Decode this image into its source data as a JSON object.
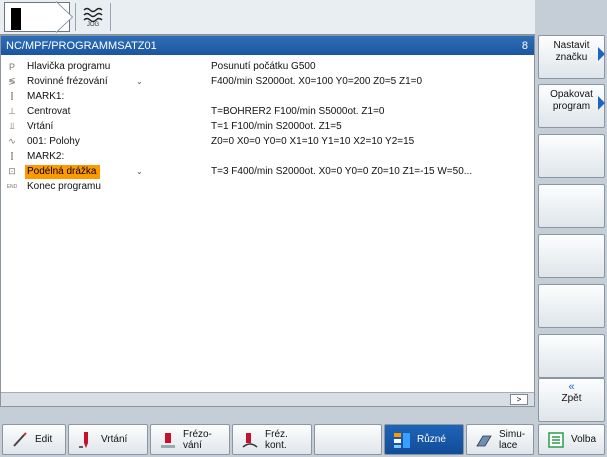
{
  "topbar": {
    "jog_label": "JOG"
  },
  "editor": {
    "path": "NC/MPF/PROGRAMMSATZ01",
    "channel_number": "8",
    "more_button": ">",
    "rows": [
      {
        "icon": "P",
        "icon_name": "program-header-icon",
        "name": "Hlavička programu",
        "val": "Posunutí počátku G500",
        "selected": false,
        "chev": ""
      },
      {
        "icon": "≶",
        "icon_name": "face-milling-icon",
        "name": "Rovinné frézování",
        "val": "F400/min S2000ot. X0=100 Y0=200 Z0=5 Z1=0",
        "selected": false,
        "chev": "⌄"
      },
      {
        "icon": "⫿",
        "icon_name": "mark-icon",
        "name": "MARK1:",
        "val": "",
        "selected": false,
        "chev": ""
      },
      {
        "icon": "⊥",
        "icon_name": "centering-icon",
        "name": "Centrovat",
        "val": "T=BOHRER2 F100/min S5000ot. Z1=0",
        "selected": false,
        "chev": ""
      },
      {
        "icon": "⫫",
        "icon_name": "drilling-icon",
        "name": "Vrtání",
        "val": "T=1 F100/min S2000ot. Z1=5",
        "selected": false,
        "chev": ""
      },
      {
        "icon": "∿",
        "icon_name": "positions-icon",
        "name": "001: Polohy",
        "val": "Z0=0 X0=0 Y0=0 X1=10 Y1=10 X2=10 Y2=15",
        "selected": false,
        "chev": ""
      },
      {
        "icon": "⫿",
        "icon_name": "mark-icon",
        "name": "MARK2:",
        "val": "",
        "selected": false,
        "chev": ""
      },
      {
        "icon": "⊡",
        "icon_name": "longitudinal-slot-icon",
        "name": "Podélná drážka",
        "val": "T=3 F400/min S2000ot. X0=0 Y0=0 Z0=10 Z1=-15 W=50...",
        "selected": true,
        "chev": "⌄"
      },
      {
        "icon": "END",
        "icon_name": "program-end-icon",
        "name": "Konec programu",
        "val": "",
        "selected": false,
        "chev": ""
      }
    ]
  },
  "vertical_softkeys": {
    "set_mark": {
      "line1": "Nastavit",
      "line2": "značku"
    },
    "repeat_program": {
      "line1": "Opakovat",
      "line2": "program"
    },
    "back": {
      "chevron": "«",
      "label": "Zpět"
    }
  },
  "horizontal_softkeys": {
    "edit": "Edit",
    "drilling": "Vrtání",
    "milling": {
      "line1": "Frézo-",
      "line2": "vání"
    },
    "contour_milling": {
      "line1": "Fréz.",
      "line2": "kont."
    },
    "various": "Různé",
    "simulation": {
      "line1": "Simu-",
      "line2": "lace"
    },
    "select": "Volba"
  },
  "colors": {
    "header_blue": "#1b56a0",
    "selection_orange": "#ff9900",
    "accent_blue": "#1c66c0"
  }
}
